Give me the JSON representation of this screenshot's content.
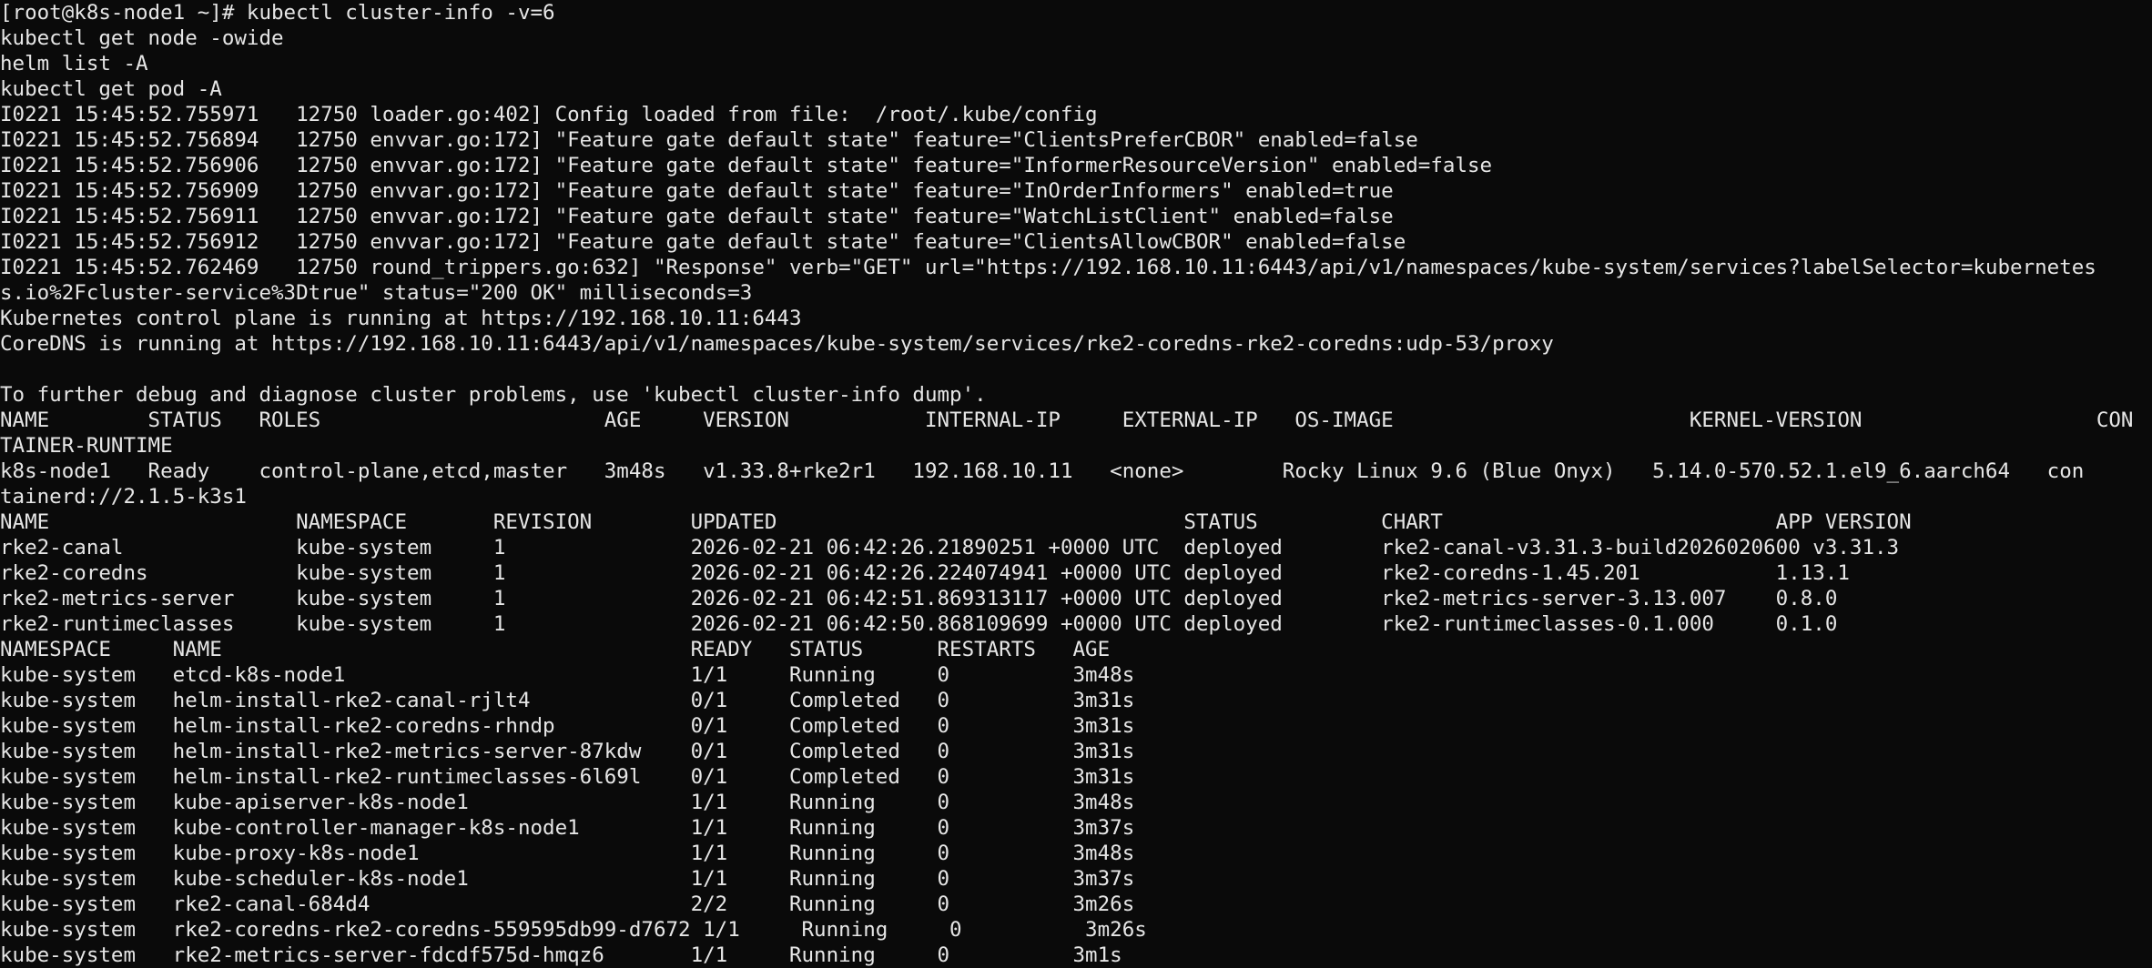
{
  "terminal": {
    "lines": [
      "[root@k8s-node1 ~]# kubectl cluster-info -v=6",
      "kubectl get node -owide",
      "helm list -A",
      "kubectl get pod -A",
      "I0221 15:45:52.755971   12750 loader.go:402] Config loaded from file:  /root/.kube/config",
      "I0221 15:45:52.756894   12750 envvar.go:172] \"Feature gate default state\" feature=\"ClientsPreferCBOR\" enabled=false",
      "I0221 15:45:52.756906   12750 envvar.go:172] \"Feature gate default state\" feature=\"InformerResourceVersion\" enabled=false",
      "I0221 15:45:52.756909   12750 envvar.go:172] \"Feature gate default state\" feature=\"InOrderInformers\" enabled=true",
      "I0221 15:45:52.756911   12750 envvar.go:172] \"Feature gate default state\" feature=\"WatchListClient\" enabled=false",
      "I0221 15:45:52.756912   12750 envvar.go:172] \"Feature gate default state\" feature=\"ClientsAllowCBOR\" enabled=false",
      "I0221 15:45:52.762469   12750 round_trippers.go:632] \"Response\" verb=\"GET\" url=\"https://192.168.10.11:6443/api/v1/namespaces/kube-system/services?labelSelector=kubernetes",
      "s.io%2Fcluster-service%3Dtrue\" status=\"200 OK\" milliseconds=3",
      "Kubernetes control plane is running at https://192.168.10.11:6443",
      "CoreDNS is running at https://192.168.10.11:6443/api/v1/namespaces/kube-system/services/rke2-coredns-rke2-coredns:udp-53/proxy",
      "",
      "To further debug and diagnose cluster problems, use 'kubectl cluster-info dump'.",
      "NAME        STATUS   ROLES                       AGE     VERSION           INTERNAL-IP     EXTERNAL-IP   OS-IMAGE                        KERNEL-VERSION                   CON",
      "TAINER-RUNTIME",
      "k8s-node1   Ready    control-plane,etcd,master   3m48s   v1.33.8+rke2r1   192.168.10.11   <none>        Rocky Linux 9.6 (Blue Onyx)   5.14.0-570.52.1.el9_6.aarch64   con",
      "tainerd://2.1.5-k3s1",
      "NAME                    NAMESPACE       REVISION        UPDATED                                 STATUS          CHART                           APP VERSION",
      "rke2-canal              kube-system     1               2026-02-21 06:42:26.21890251 +0000 UTC  deployed        rke2-canal-v3.31.3-build2026020600 v3.31.3",
      "rke2-coredns            kube-system     1               2026-02-21 06:42:26.224074941 +0000 UTC deployed        rke2-coredns-1.45.201           1.13.1",
      "rke2-metrics-server     kube-system     1               2026-02-21 06:42:51.869313117 +0000 UTC deployed        rke2-metrics-server-3.13.007    0.8.0",
      "rke2-runtimeclasses     kube-system     1               2026-02-21 06:42:50.868109699 +0000 UTC deployed        rke2-runtimeclasses-0.1.000     0.1.0",
      "NAMESPACE     NAME                                      READY   STATUS      RESTARTS   AGE",
      "kube-system   etcd-k8s-node1                            1/1     Running     0          3m48s",
      "kube-system   helm-install-rke2-canal-rjlt4             0/1     Completed   0          3m31s",
      "kube-system   helm-install-rke2-coredns-rhndp           0/1     Completed   0          3m31s",
      "kube-system   helm-install-rke2-metrics-server-87kdw    0/1     Completed   0          3m31s",
      "kube-system   helm-install-rke2-runtimeclasses-6l69l    0/1     Completed   0          3m31s",
      "kube-system   kube-apiserver-k8s-node1                  1/1     Running     0          3m48s",
      "kube-system   kube-controller-manager-k8s-node1         1/1     Running     0          3m37s",
      "kube-system   kube-proxy-k8s-node1                      1/1     Running     0          3m48s",
      "kube-system   kube-scheduler-k8s-node1                  1/1     Running     0          3m37s",
      "kube-system   rke2-canal-684d4                          2/2     Running     0          3m26s",
      "kube-system   rke2-coredns-rke2-coredns-559595db99-d7672 1/1     Running     0          3m26s",
      "kube-system   rke2-metrics-server-fdcdf575d-hmqz6       1/1     Running     0          3m1s"
    ]
  },
  "colors": {
    "background": "#0a0a0a",
    "foreground": "#e6e6e6"
  }
}
